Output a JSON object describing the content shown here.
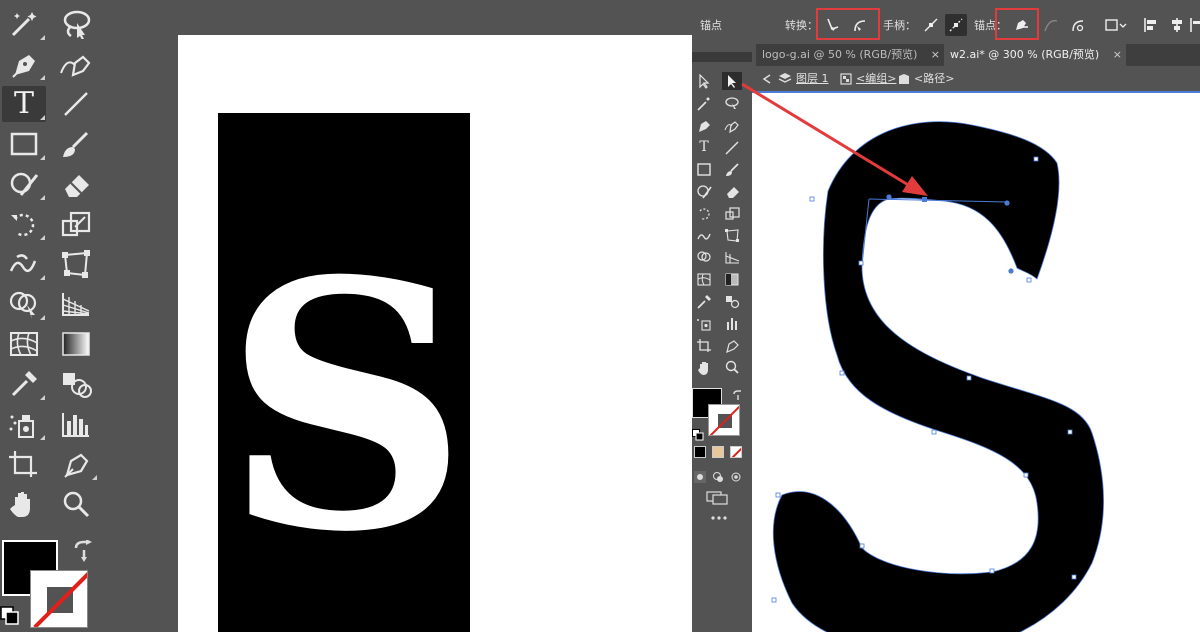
{
  "left_zoom": {
    "letter": "S",
    "tools": [
      {
        "name": "magic-wand-icon"
      },
      {
        "name": "lasso-icon"
      },
      {
        "name": "pen-icon"
      },
      {
        "name": "curvature-pen-icon"
      },
      {
        "name": "type-icon"
      },
      {
        "name": "line-segment-icon"
      },
      {
        "name": "rectangle-icon"
      },
      {
        "name": "paintbrush-icon"
      },
      {
        "name": "shaper-icon"
      },
      {
        "name": "eraser-icon"
      },
      {
        "name": "rotate-icon"
      },
      {
        "name": "scale-icon"
      },
      {
        "name": "warp-icon"
      },
      {
        "name": "free-transform-icon"
      },
      {
        "name": "shape-builder-icon"
      },
      {
        "name": "perspective-grid-icon"
      },
      {
        "name": "mesh-icon"
      },
      {
        "name": "gradient-icon"
      },
      {
        "name": "eyedropper-icon"
      },
      {
        "name": "blend-icon"
      },
      {
        "name": "symbol-sprayer-icon"
      },
      {
        "name": "column-graph-icon"
      },
      {
        "name": "artboard-icon"
      },
      {
        "name": "slice-icon"
      },
      {
        "name": "hand-icon"
      },
      {
        "name": "zoom-icon"
      }
    ],
    "type_glyph": "T"
  },
  "control_bar": {
    "anchor_label": "锚点",
    "convert_label": "转换：",
    "handles_label": "手柄：",
    "anchors_label": "锚点："
  },
  "tabs": [
    {
      "label": "logo-g.ai @ 50 % (RGB/预览)",
      "active": false,
      "close": "×"
    },
    {
      "label": "w2.ai* @ 300 % (RGB/预览)",
      "active": true,
      "close": "×"
    }
  ],
  "breadcrumb": {
    "layer": "图层 1",
    "group": "<编组>",
    "path": "<路径>"
  },
  "small_type_glyph": "T",
  "colors": {
    "annotation_red": "#e23b3b",
    "path_blue": "#4b7bd8",
    "ui_gray": "#535353",
    "fill_black": "#000000"
  }
}
